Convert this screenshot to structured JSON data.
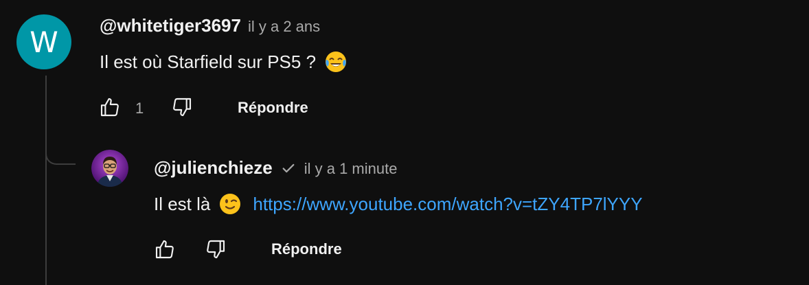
{
  "comment": {
    "avatar_letter": "W",
    "author": "@whitetiger3697",
    "time": "il y a 2 ans",
    "text": "Il est où Starfield sur PS5 ?",
    "emoji_icon": "face-with-tears-of-joy-icon",
    "like_count": "1",
    "reply_label": "Répondre",
    "avatar_color": "#0097a7"
  },
  "reply": {
    "author": "@julienchieze",
    "verified_icon": "checkmark-icon",
    "time": "il y a 1 minute",
    "text": "Il est là",
    "emoji_icon": "winking-face-icon",
    "link": "https://www.youtube.com/watch?v=tZY4TP7lYYY",
    "reply_label": "Répondre",
    "link_color": "#3ea6ff"
  }
}
